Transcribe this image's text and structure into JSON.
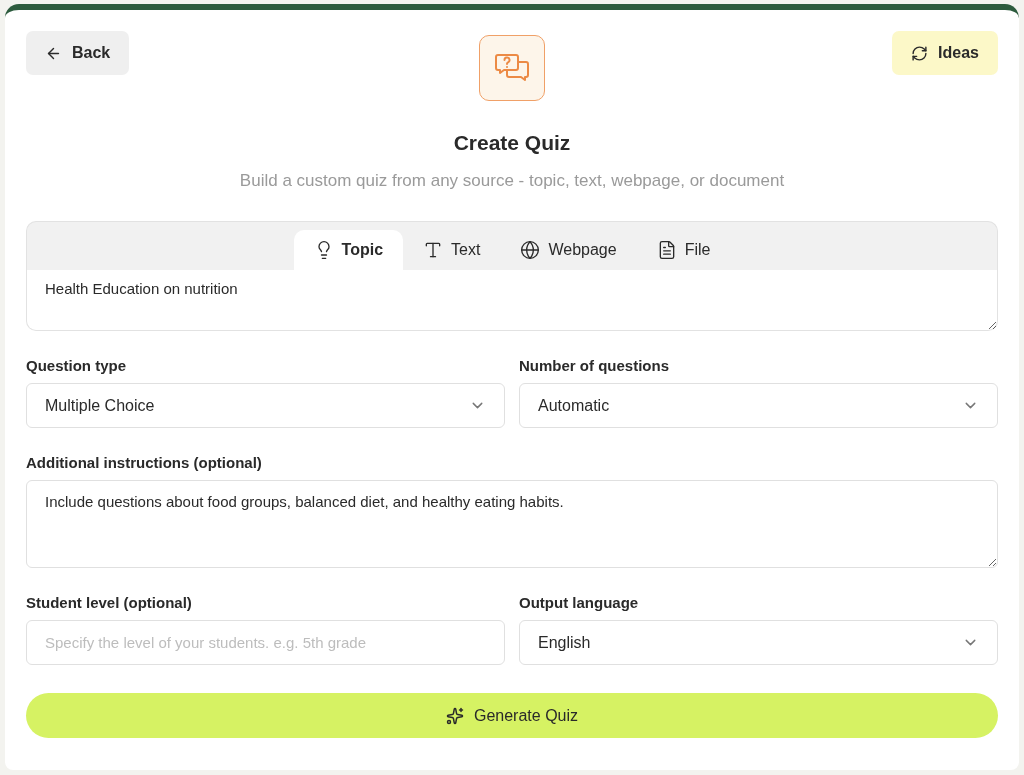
{
  "header": {
    "back": "Back",
    "ideas": "Ideas",
    "title": "Create Quiz",
    "subtitle": "Build a custom quiz from any source - topic, text, webpage, or document"
  },
  "tabs": [
    {
      "label": "Topic",
      "kind": "topic",
      "selected": true
    },
    {
      "label": "Text",
      "kind": "text",
      "selected": false
    },
    {
      "label": "Webpage",
      "kind": "webpage",
      "selected": false
    },
    {
      "label": "File",
      "kind": "file",
      "selected": false
    }
  ],
  "source_input": {
    "value": "Health Education on nutrition"
  },
  "rows": [
    {
      "fields": [
        {
          "label": "Question type",
          "kind": "select",
          "value": "Multiple Choice"
        },
        {
          "label": "Number of questions",
          "kind": "select",
          "value": "Automatic"
        }
      ]
    },
    {
      "fields": [
        {
          "label": "Additional instructions (optional)",
          "kind": "textarea",
          "value": "Include questions about food groups, balanced diet, and healthy eating habits."
        }
      ]
    },
    {
      "fields": [
        {
          "label": "Student level (optional)",
          "kind": "input",
          "placeholder": "Specify the level of your students. e.g. 5th grade"
        },
        {
          "label": "Output language",
          "kind": "select",
          "value": "English"
        }
      ]
    }
  ],
  "generate_button": "Generate Quiz"
}
